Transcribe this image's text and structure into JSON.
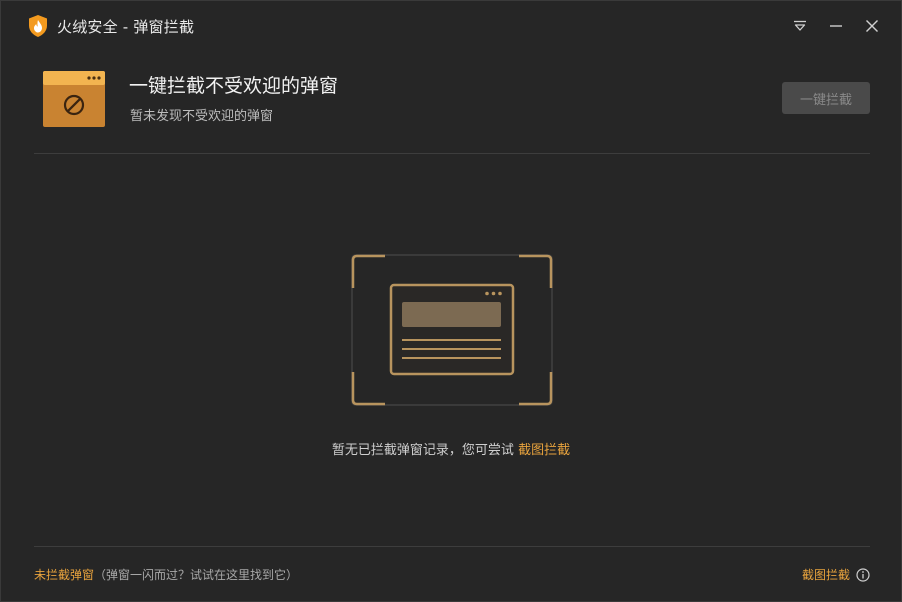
{
  "window": {
    "title": "火绒安全 - 弹窗拦截"
  },
  "header": {
    "title": "一键拦截不受欢迎的弹窗",
    "subtitle": "暂未发现不受欢迎的弹窗",
    "block_button": "一键拦截"
  },
  "empty_state": {
    "message": "暂无已拦截弹窗记录，您可尝试",
    "link": "截图拦截"
  },
  "footer": {
    "left_link": "未拦截弹窗",
    "left_hint": "（弹窗一闪而过？试试在这里找到它）",
    "right_link": "截图拦截"
  },
  "colors": {
    "accent": "#e8a33d",
    "illustration": "#b8945e",
    "background": "#262626"
  },
  "icons": {
    "app_logo": "huorong-shield-flame-icon",
    "menu": "menu-dropdown-icon",
    "minimize": "minimize-icon",
    "close": "close-icon",
    "header": "blocked-window-icon",
    "info": "info-icon"
  }
}
